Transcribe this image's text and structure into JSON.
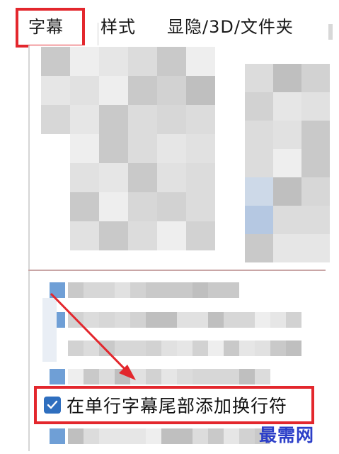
{
  "tabs": [
    {
      "label": "字幕",
      "active": true
    },
    {
      "label": "样式",
      "active": false
    },
    {
      "label": "显隐/3D/文件夹",
      "active": false
    }
  ],
  "option": {
    "label": "在单行字幕尾部添加换行符",
    "checked": true
  },
  "watermark": "最需网",
  "colors": {
    "highlight": "#e3272d",
    "checkbox": "#2f6fbf",
    "watermark": "#2b3ec8"
  }
}
